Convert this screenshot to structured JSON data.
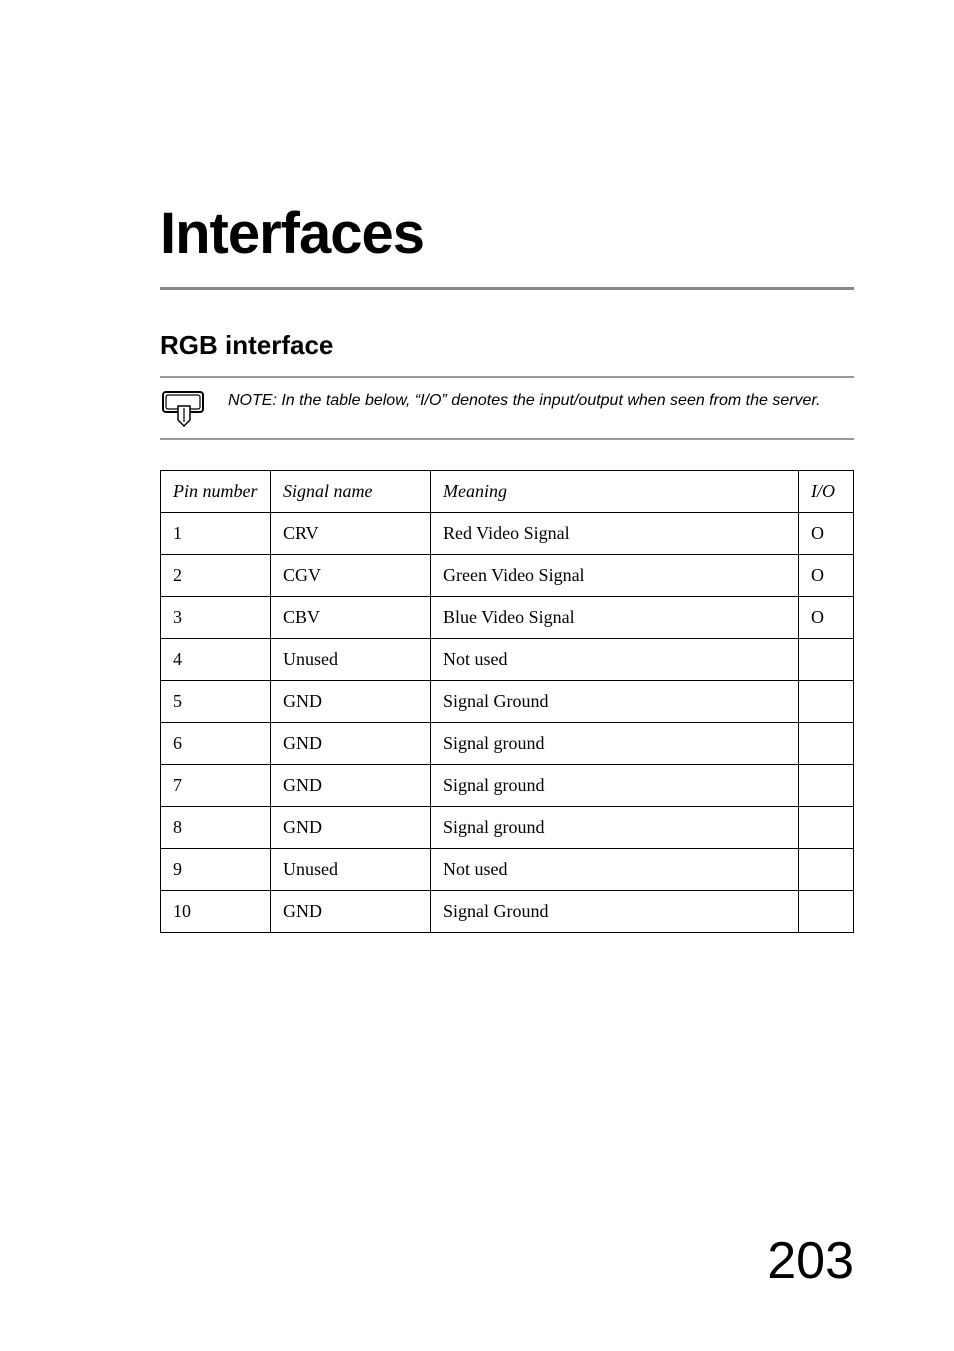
{
  "title": "Interfaces",
  "section_heading": "RGB interface",
  "note_text": "NOTE: In the table below, “I/O” denotes the input/output when seen from the server.",
  "table": {
    "headers": {
      "pin": "Pin number",
      "signal": "Signal name",
      "meaning": "Meaning",
      "io": "I/O"
    },
    "rows": [
      {
        "pin": "1",
        "signal": "CRV",
        "meaning": "Red Video Signal",
        "io": "O"
      },
      {
        "pin": "2",
        "signal": "CGV",
        "meaning": "Green Video Signal",
        "io": "O"
      },
      {
        "pin": "3",
        "signal": "CBV",
        "meaning": "Blue Video Signal",
        "io": "O"
      },
      {
        "pin": "4",
        "signal": "Unused",
        "meaning": "Not used",
        "io": ""
      },
      {
        "pin": "5",
        "signal": "GND",
        "meaning": "Signal Ground",
        "io": ""
      },
      {
        "pin": "6",
        "signal": "GND",
        "meaning": "Signal ground",
        "io": ""
      },
      {
        "pin": "7",
        "signal": "GND",
        "meaning": "Signal ground",
        "io": ""
      },
      {
        "pin": "8",
        "signal": "GND",
        "meaning": "Signal ground",
        "io": ""
      },
      {
        "pin": "9",
        "signal": "Unused",
        "meaning": "Not used",
        "io": ""
      },
      {
        "pin": "10",
        "signal": "GND",
        "meaning": "Signal Ground",
        "io": ""
      }
    ]
  },
  "page_number": "203",
  "icons": {
    "note": "note-hand-icon"
  }
}
